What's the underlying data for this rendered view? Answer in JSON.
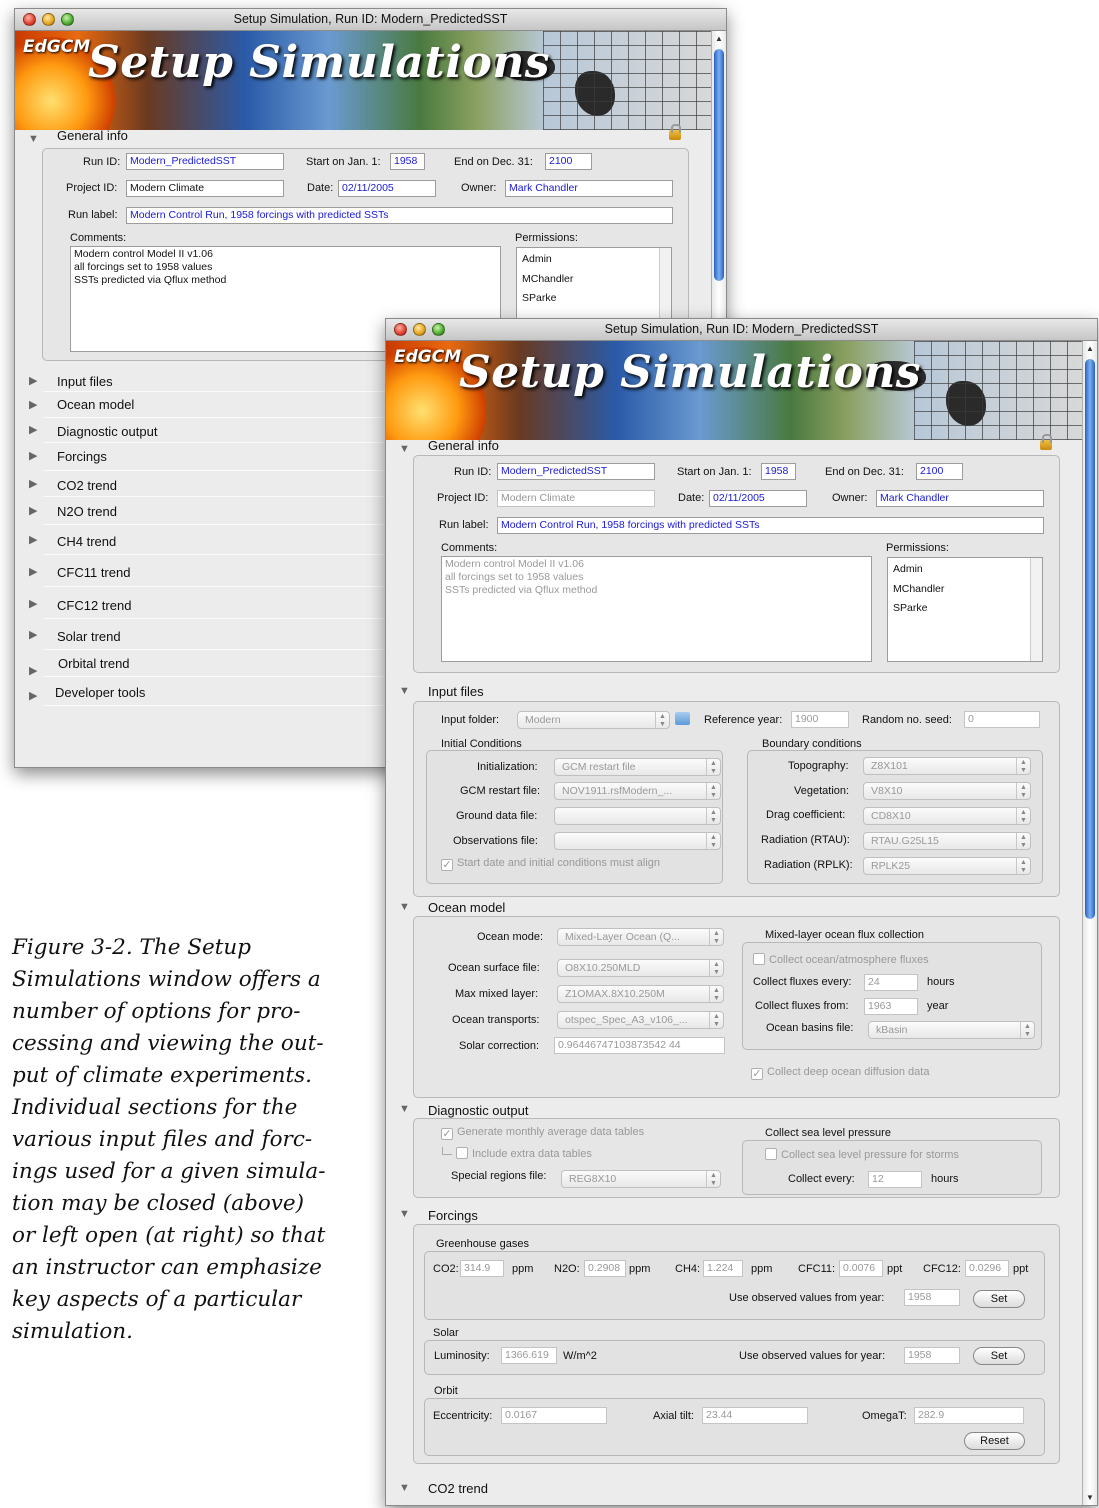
{
  "window_title": "Setup Simulation, Run ID: Modern_PredictedSST",
  "banner": {
    "brand": "EdGCM",
    "title": "Setup Simulations"
  },
  "general_info": {
    "header": "General info",
    "run_id_label": "Run ID:",
    "run_id": "Modern_PredictedSST",
    "start_label": "Start on Jan. 1:",
    "start": "1958",
    "end_label": "End on Dec. 31:",
    "end": "2100",
    "project_id_label": "Project ID:",
    "project_id": "Modern Climate",
    "date_label": "Date:",
    "date": "02/11/2005",
    "owner_label": "Owner:",
    "owner": "Mark Chandler",
    "run_label_label": "Run label:",
    "run_label": "Modern Control Run, 1958 forcings with predicted SSTs",
    "comments_label": "Comments:",
    "comments": "Modern control Model II v1.06\nall forcings set to 1958 values\nSSTs predicted via Qflux method",
    "permissions_label": "Permissions:",
    "permissions": [
      "Admin",
      "MChandler",
      "SParke"
    ]
  },
  "collapsed_sections": [
    "Input files",
    "Ocean model",
    "Diagnostic output",
    "Forcings",
    "CO2 trend",
    "N2O trend",
    "CH4 trend",
    "CFC11 trend",
    "CFC12 trend",
    "Solar trend",
    "Orbital trend",
    "Developer tools"
  ],
  "input_files": {
    "header": "Input files",
    "input_folder_label": "Input folder:",
    "input_folder": "Modern",
    "reference_year_label": "Reference year:",
    "reference_year": "1900",
    "random_seed_label": "Random no. seed:",
    "random_seed": "0",
    "initial_conditions": {
      "label": "Initial Conditions",
      "initialization_label": "Initialization:",
      "initialization": "GCM restart file",
      "gcm_restart_label": "GCM restart file:",
      "gcm_restart": "NOV1911.rsfModern_...",
      "ground_data_label": "Ground data file:",
      "ground_data": "",
      "observations_label": "Observations file:",
      "observations": "",
      "align_checkbox": "Start date and initial conditions must align"
    },
    "boundary_conditions": {
      "label": "Boundary conditions",
      "topography_label": "Topography:",
      "topography": "Z8X101",
      "vegetation_label": "Vegetation:",
      "vegetation": "V8X10",
      "drag_label": "Drag coefficient:",
      "drag": "CD8X10",
      "rtau_label": "Radiation (RTAU):",
      "rtau": "RTAU.G25L15",
      "rplk_label": "Radiation (RPLK):",
      "rplk": "RPLK25"
    }
  },
  "ocean_model": {
    "header": "Ocean model",
    "mode_label": "Ocean mode:",
    "mode": "Mixed-Layer Ocean (Q...",
    "surface_label": "Ocean surface file:",
    "surface": "O8X10.250MLD",
    "max_mixed_label": "Max mixed layer:",
    "max_mixed": "Z1OMAX.8X10.250M",
    "transports_label": "Ocean transports:",
    "transports": "otspec_Spec_A3_v106_...",
    "solar_corr_label": "Solar correction:",
    "solar_corr": "0.96446747103873542 44",
    "flux_collection": {
      "label": "Mixed-layer ocean flux collection",
      "collect_checkbox": "Collect ocean/atmosphere fluxes",
      "every_label": "Collect fluxes every:",
      "every": "24",
      "every_unit": "hours",
      "from_label": "Collect fluxes from:",
      "from": "1963",
      "from_unit": "year",
      "basins_label": "Ocean basins file:",
      "basins": "kBasin"
    },
    "deep_checkbox": "Collect deep ocean diffusion data"
  },
  "diagnostic_output": {
    "header": "Diagnostic output",
    "monthly_checkbox": "Generate monthly average data tables",
    "extra_checkbox": "Include extra data tables",
    "special_label": "Special regions file:",
    "special": "REG8X10",
    "slp": {
      "label": "Collect sea level pressure",
      "storms_checkbox": "Collect sea level pressure for storms",
      "every_label": "Collect every:",
      "every": "12",
      "every_unit": "hours"
    }
  },
  "forcings": {
    "header": "Forcings",
    "ghg": {
      "label": "Greenhouse gases",
      "co2_label": "CO2:",
      "co2": "314.9",
      "co2_unit": "ppm",
      "n2o_label": "N2O:",
      "n2o": "0.2908",
      "n2o_unit": "ppm",
      "ch4_label": "CH4:",
      "ch4": "1.224",
      "ch4_unit": "ppm",
      "cfc11_label": "CFC11:",
      "cfc11": "0.0076",
      "cfc11_unit": "ppt",
      "cfc12_label": "CFC12:",
      "cfc12": "0.0296",
      "cfc12_unit": "ppt",
      "observed_label": "Use observed values from year:",
      "observed_year": "1958",
      "set_button": "Set"
    },
    "solar": {
      "label": "Solar",
      "luminosity_label": "Luminosity:",
      "luminosity": "1366.619",
      "luminosity_unit": "W/m^2",
      "observed_label": "Use observed values for year:",
      "observed_year": "1958",
      "set_button": "Set"
    },
    "orbit": {
      "label": "Orbit",
      "eccentricity_label": "Eccentricity:",
      "eccentricity": "0.0167",
      "axial_label": "Axial tilt:",
      "axial": "23.44",
      "omega_label": "OmegaT:",
      "omega": "282.9",
      "reset_button": "Reset"
    }
  },
  "co2_trend_header": "CO2 trend",
  "caption": [
    "Figure 3-2. The Setup",
    "Simulations window offers a",
    "number of options for pro-",
    "cessing and viewing the out-",
    "put of climate experiments.",
    "Individual sections for the",
    "various input files and forc-",
    "ings used for a given simula-",
    "tion may be closed (above)",
    "or left open (at right) so that",
    "an instructor can emphasize",
    "key aspects of a particular",
    "simulation."
  ]
}
